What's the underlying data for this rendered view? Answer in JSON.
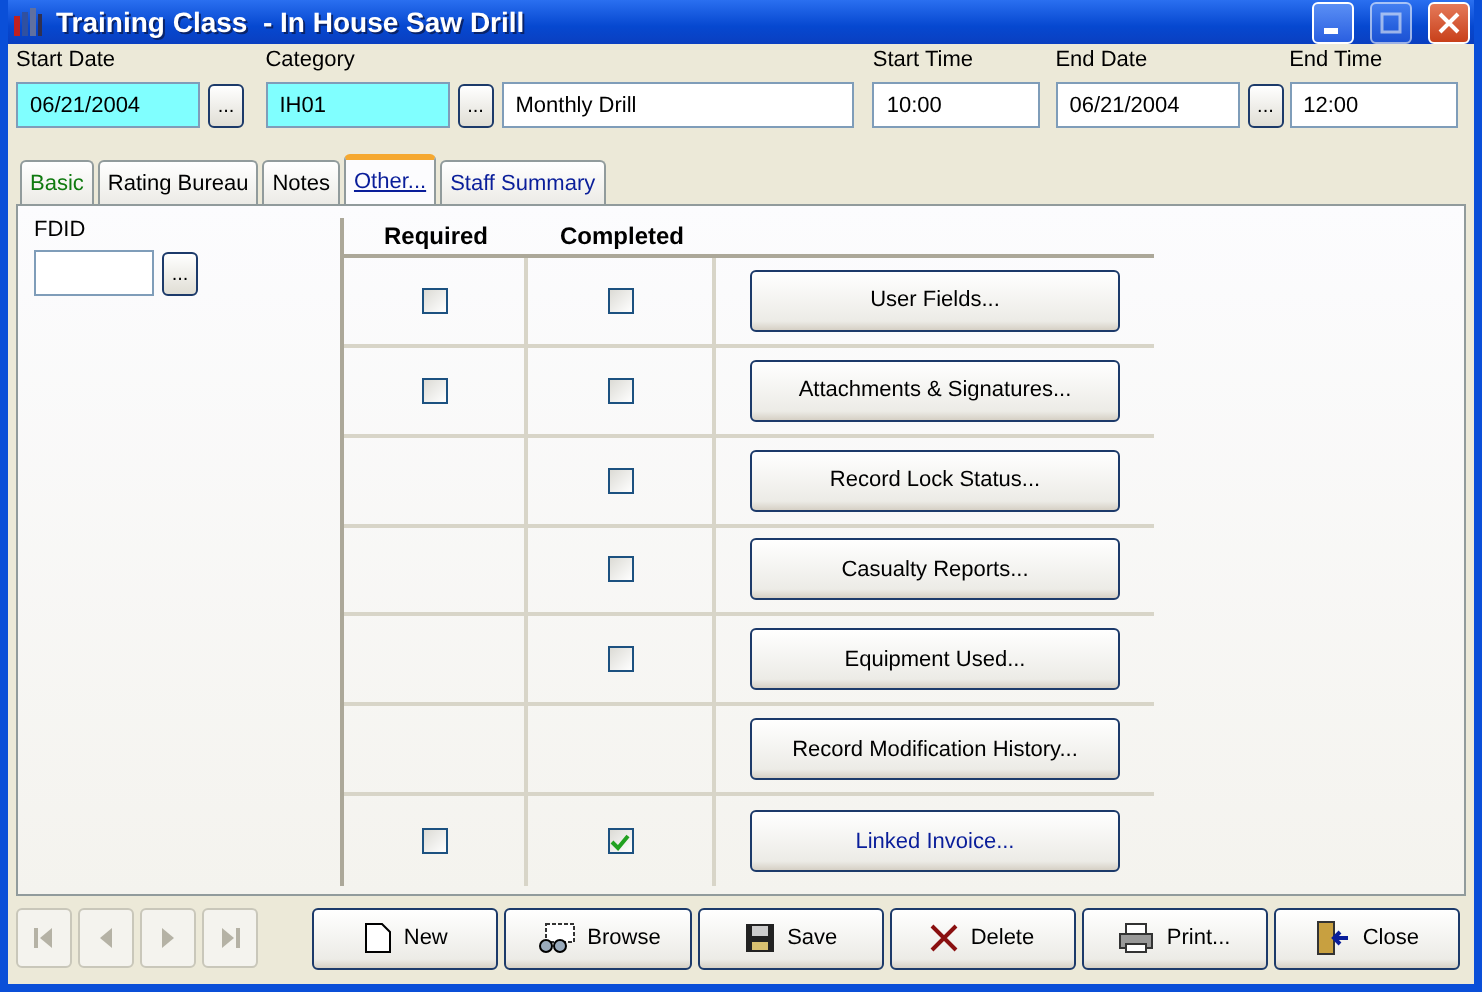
{
  "window": {
    "title": "Training Class  - In House Saw Drill"
  },
  "header_fields": [
    {
      "label": "Start Date",
      "value": "06/21/2004",
      "required": true,
      "browse_button": "..."
    },
    {
      "label": "Category",
      "value": "IH01",
      "required": true,
      "browse_button": "...",
      "description": "Monthly Drill"
    },
    {
      "label": "Start Time",
      "value": "10:00",
      "required": false
    },
    {
      "label": "End Date",
      "value": "06/21/2004",
      "required": false,
      "browse_button": "..."
    },
    {
      "label": "End Time",
      "value": "12:00",
      "required": false
    }
  ],
  "tabs": [
    {
      "label": "Basic",
      "selected": false,
      "color": "#0f7a0f"
    },
    {
      "label": "Rating Bureau",
      "selected": false,
      "color": "#000000"
    },
    {
      "label": "Notes",
      "selected": false,
      "color": "#000000"
    },
    {
      "label": "Other...",
      "selected": true,
      "color": "#0a1e9a"
    },
    {
      "label": "Staff Summary",
      "selected": false,
      "color": "#0a1e9a"
    }
  ],
  "fdid": {
    "label": "FDID",
    "browse_button": "..."
  },
  "table": {
    "columns": [
      "Required",
      "Completed"
    ],
    "rows": [
      {
        "required": false,
        "completed": false,
        "button": "User Fields...",
        "linked": false
      },
      {
        "required": false,
        "completed": false,
        "button": "Attachments & Signatures...",
        "linked": false
      },
      {
        "completed": false,
        "button": "Record Lock Status...",
        "linked": false
      },
      {
        "completed": false,
        "button": "Casualty Reports...",
        "linked": false
      },
      {
        "completed": false,
        "button": "Equipment Used...",
        "linked": false
      },
      {
        "button": "Record Modification History...",
        "linked": false
      },
      {
        "required": false,
        "completed": true,
        "button": "Linked Invoice...",
        "linked": true
      }
    ]
  },
  "nav_buttons": [
    {
      "kind": "first",
      "disabled": true
    },
    {
      "kind": "prev",
      "disabled": true
    },
    {
      "kind": "next",
      "disabled": true
    },
    {
      "kind": "last",
      "disabled": true
    }
  ],
  "actions": [
    {
      "kind": "new",
      "label": "New"
    },
    {
      "kind": "browse",
      "label": "Browse"
    },
    {
      "kind": "save",
      "label": "Save"
    },
    {
      "kind": "delete",
      "label": "Delete"
    },
    {
      "kind": "print",
      "label": "Print..."
    },
    {
      "kind": "close",
      "label": "Close"
    }
  ]
}
